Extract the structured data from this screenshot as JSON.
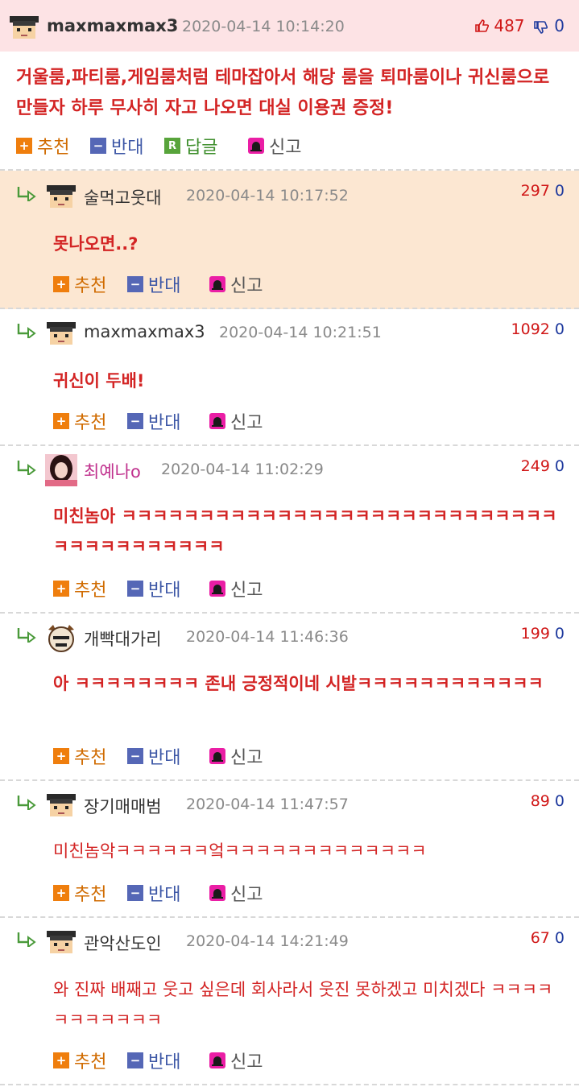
{
  "actions": {
    "recommend": "추천",
    "oppose": "반대",
    "reply": "답글",
    "report": "신고"
  },
  "main": {
    "nick": "maxmaxmax3",
    "date": "2020-04-14 10:14:20",
    "up": "487",
    "down": "0",
    "text": "거울룸,파티룸,게임룸처럼 테마잡아서 해당 룸을 퇴마룸이나 귀신룸으로 만들자 하루 무사히 자고 나오면 대실 이용권 증정!"
  },
  "replies": [
    {
      "nick": "술먹고웃대",
      "date": "2020-04-14 10:17:52",
      "up": "297",
      "down": "0",
      "text": "못나오면..?"
    },
    {
      "nick": "maxmaxmax3",
      "date": "2020-04-14 10:21:51",
      "up": "1092",
      "down": "0",
      "text": "귀신이 두배!"
    },
    {
      "nick": "최예나o",
      "date": "2020-04-14 11:02:29",
      "up": "249",
      "down": "0",
      "text": "미친놈아 ㅋㅋㅋㅋㅋㅋㅋㅋㅋㅋㅋㅋㅋㅋㅋㅋㅋㅋㅋㅋㅋㅋㅋㅋㅋㅋㅋㅋㅋㅋㅋㅋㅋㅋㅋㅋㅋㅋㅋ"
    },
    {
      "nick": "개빡대가리",
      "date": "2020-04-14 11:46:36",
      "up": "199",
      "down": "0",
      "text": "아 ㅋㅋㅋㅋㅋㅋㅋㅋ 존내 긍정적이네 시발ㅋㅋㅋㅋㅋㅋㅋㅋㅋㅋㅋㅋ"
    },
    {
      "nick": "장기매매범",
      "date": "2020-04-14 11:47:57",
      "up": "89",
      "down": "0",
      "text": "미친놈악ㅋㅋㅋㅋㅋㅋ엌ㅋㅋㅋㅋㅋㅋㅋㅋㅋㅋㅋㅋㅋ"
    },
    {
      "nick": "관악산도인",
      "date": "2020-04-14 14:21:49",
      "up": "67",
      "down": "0",
      "text": "와 진짜 배째고 웃고 싶은데 회사라서 웃진 못하겠고 미치겠다 ㅋㅋㅋㅋㅋㅋㅋㅋㅋㅋㅋ"
    }
  ],
  "colors": {
    "text": "#d32424",
    "upvote": "#d01717",
    "downvote": "#1f3a9e",
    "best_bg": "#fce7d2",
    "main_header_bg": "#fde3e5"
  }
}
